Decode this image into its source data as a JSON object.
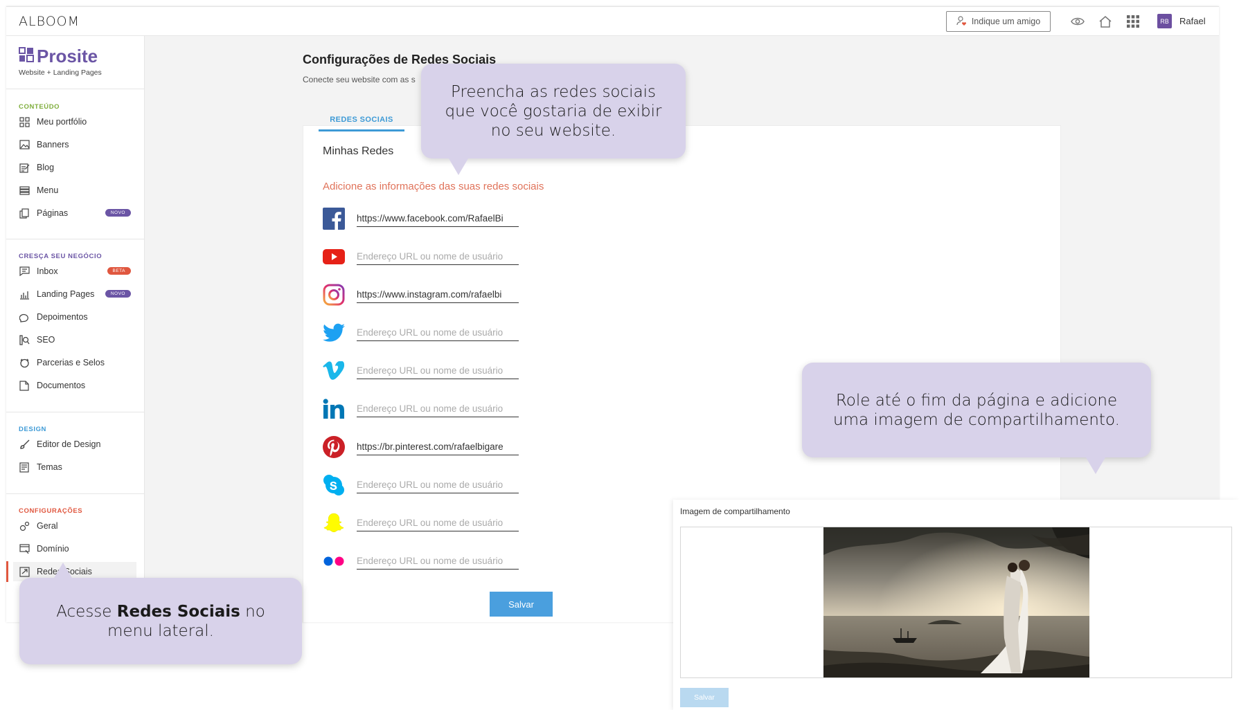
{
  "topbar": {
    "logo": "ALBOOM",
    "refer_button": "Indique um amigo",
    "avatar_initials": "RB",
    "username": "Rafael"
  },
  "sidebar": {
    "brand": "Prosite",
    "brand_sub": "Website + Landing Pages",
    "sections": [
      {
        "title": "CONTEÚDO",
        "color": "#7fae3c",
        "items": [
          "Meu portfólio",
          "Banners",
          "Blog",
          "Menu",
          "Páginas"
        ]
      },
      {
        "title": "CRESÇA SEU NEGÓCIO",
        "color": "#6b55a5",
        "items": [
          "Inbox",
          "Landing Pages",
          "Depoimentos",
          "SEO",
          "Parcerias e Selos",
          "Documentos"
        ]
      },
      {
        "title": "DESIGN",
        "color": "#3d9ad6",
        "items": [
          "Editor de Design",
          "Temas"
        ]
      },
      {
        "title": "CONFIGURAÇÕES",
        "color": "#e0573f",
        "items": [
          "Geral",
          "Domínio",
          "Redes Sociais"
        ]
      }
    ],
    "badges": {
      "paginas": "NOVO",
      "inbox": "BETA",
      "landing": "NOVO"
    }
  },
  "main": {
    "title": "Configurações de Redes Sociais",
    "subtitle": "Conecte seu website com as s",
    "tab": "REDES SOCIAIS",
    "card_title": "Minhas Redes",
    "card_subtitle": "Adicione as informações das suas redes sociais",
    "placeholder": "Endereço URL ou nome de usuário",
    "networks": [
      {
        "name": "facebook-icon",
        "value": "https://www.facebook.com/RafaelBi"
      },
      {
        "name": "youtube-icon",
        "value": ""
      },
      {
        "name": "instagram-icon",
        "value": "https://www.instagram.com/rafaelbi"
      },
      {
        "name": "twitter-icon",
        "value": ""
      },
      {
        "name": "vimeo-icon",
        "value": ""
      },
      {
        "name": "linkedin-icon",
        "value": ""
      },
      {
        "name": "pinterest-icon",
        "value": "https://br.pinterest.com/rafaelbigare"
      },
      {
        "name": "skype-icon",
        "value": ""
      },
      {
        "name": "snapchat-icon",
        "value": ""
      },
      {
        "name": "flickr-icon",
        "value": ""
      }
    ],
    "save": "Salvar"
  },
  "share": {
    "label": "Imagem de compartilhamento",
    "save": "Salvar"
  },
  "tooltips": {
    "tip1": "Preencha as redes sociais que você gostaria de exibir no seu website.",
    "tip2": "Role até o fim da página e adicione uma imagem de compartilhamento.",
    "tip3_pre": "Acesse",
    "tip3_bold": "Redes Sociais",
    "tip3_post": "no menu lateral."
  }
}
